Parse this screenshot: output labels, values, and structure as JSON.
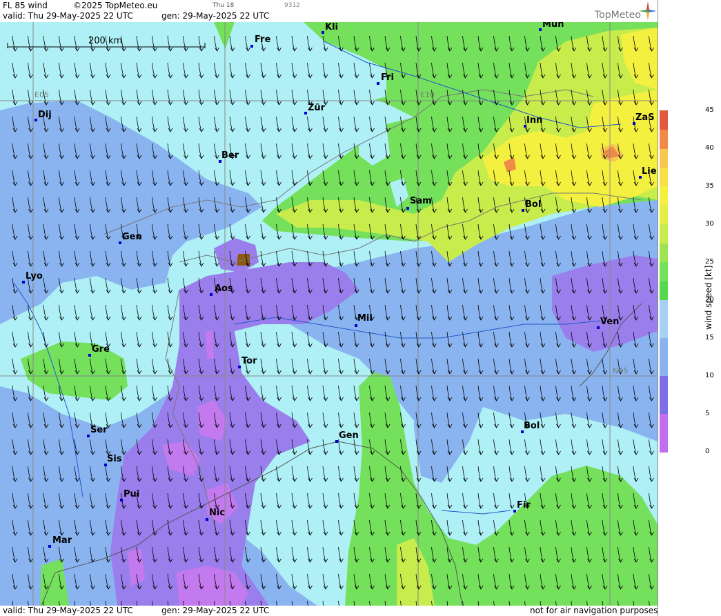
{
  "header": {
    "title": "FL 85 wind",
    "copyright": "©2025 TopMeteo.eu",
    "run": "Thu 18",
    "code": "9312",
    "valid": "valid:  Thu   29-May-2025  22 UTC",
    "gen": "gen: 29-May-2025 22 UTC",
    "logo": "TopMeteo"
  },
  "footer": {
    "valid": "valid:  Thu   29-May-2025  22 UTC",
    "gen": "gen: 29-May-2025 22 UTC",
    "disclaimer": "not for air navigation purposes"
  },
  "scale_bar": "200 km",
  "grid_labels": {
    "e05": "E05",
    "e10": "E10",
    "n45": "N45"
  },
  "cities": [
    {
      "name": "Kli"
    },
    {
      "name": "Mun"
    },
    {
      "name": "Fre"
    },
    {
      "name": "Fri"
    },
    {
      "name": "Dij"
    },
    {
      "name": "Zür"
    },
    {
      "name": "Inn"
    },
    {
      "name": "ZaS"
    },
    {
      "name": "Ber"
    },
    {
      "name": "Lie"
    },
    {
      "name": "Sam"
    },
    {
      "name": "Bol"
    },
    {
      "name": "Gen"
    },
    {
      "name": "Lyo"
    },
    {
      "name": "Aos"
    },
    {
      "name": "Mil"
    },
    {
      "name": "Ven"
    },
    {
      "name": "Gre"
    },
    {
      "name": "Tor"
    },
    {
      "name": "Ser"
    },
    {
      "name": "Gen"
    },
    {
      "name": "Bol"
    },
    {
      "name": "Sis"
    },
    {
      "name": "Pui"
    },
    {
      "name": "Nic"
    },
    {
      "name": "Fir"
    },
    {
      "name": "Mar"
    }
  ],
  "legend": {
    "title": "wind speed [kt]",
    "ticks": [
      "45",
      "40",
      "35",
      "30",
      "25",
      "20",
      "15",
      "10",
      "5",
      "0"
    ],
    "colors": [
      "#e05a3c",
      "#f08a48",
      "#f7c850",
      "#f4f040",
      "#c8ec4c",
      "#74e05c",
      "#46d448",
      "#a8d0f4",
      "#aef0f6",
      "#8ab4f0",
      "#7e6ee8",
      "#9460ec",
      "#c070ee"
    ]
  },
  "wind_direction": "south-southeast (northerly flow)"
}
